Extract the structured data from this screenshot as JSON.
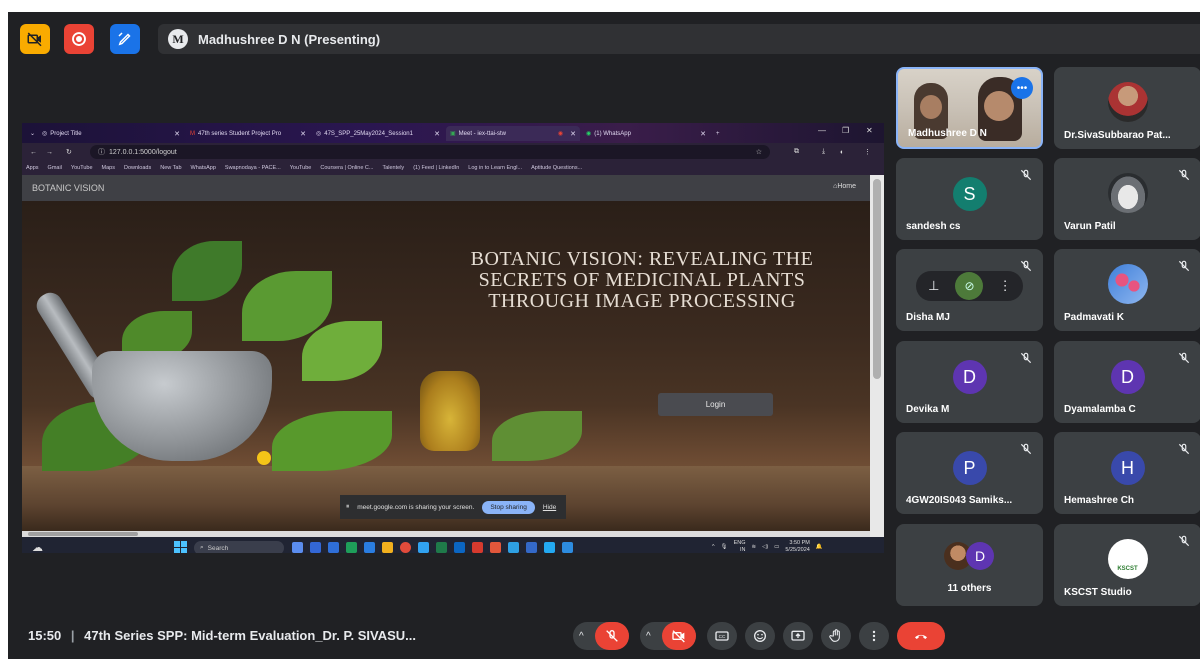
{
  "presenter": {
    "avatar_letter": "M",
    "label": "Madhushree D N (Presenting)"
  },
  "browser": {
    "tabs": [
      {
        "label": "Project Title",
        "icon": "globe-icon"
      },
      {
        "label": "47th series Student Project Pro",
        "icon": "gmail-icon"
      },
      {
        "label": "47S_SPP_25May2024_Session1",
        "icon": "globe-icon"
      },
      {
        "label": "Meet - iex-ttai-stw",
        "icon": "meet-icon"
      },
      {
        "label": "(1) WhatsApp",
        "icon": "whatsapp-icon"
      }
    ],
    "url": "127.0.0.1:5000/logout",
    "bookmarks": [
      "Apps",
      "Gmail",
      "YouTube",
      "Maps",
      "Downloads",
      "New Tab",
      "WhatsApp",
      "Swapnodaya - PACE...",
      "YouTube",
      "Coursera | Online C...",
      "Talentely",
      "(1) Feed | LinkedIn",
      "Log in to Learn Engl...",
      "Aptitude Questions..."
    ]
  },
  "site": {
    "brand": "BOTANIC VISION",
    "home_link": "Home",
    "hero_title": "BOTANIC VISION: REVEALING THE SECRETS OF MEDICINAL PLANTS THROUGH IMAGE PROCESSING",
    "login_label": "Login"
  },
  "share_notice": {
    "text": "meet.google.com is sharing your screen.",
    "stop_label": "Stop sharing",
    "hide_label": "Hide"
  },
  "taskbar": {
    "search_label": "Search",
    "lang_top": "ENG",
    "lang_bottom": "IN",
    "time": "3:50 PM",
    "date": "5/25/2024"
  },
  "participants": [
    {
      "name": "Madhushree D N",
      "type": "video"
    },
    {
      "name": "Dr.SivaSubbarao Pat...",
      "type": "photo"
    },
    {
      "name": "sandesh cs",
      "type": "letter",
      "letter": "S",
      "color": "#137e6f"
    },
    {
      "name": "Varun Patil",
      "type": "photo"
    },
    {
      "name": "Disha MJ",
      "type": "hover"
    },
    {
      "name": "Padmavati K",
      "type": "photo"
    },
    {
      "name": "Devika M",
      "type": "letter",
      "letter": "D",
      "color": "#5e35b1"
    },
    {
      "name": "Dyamalamba C",
      "type": "letter",
      "letter": "D",
      "color": "#5e35b1"
    },
    {
      "name": "4GW20IS043 Samiks...",
      "type": "letter",
      "letter": "P",
      "color": "#3949ab"
    },
    {
      "name": "Hemashree Ch",
      "type": "letter",
      "letter": "H",
      "color": "#3949ab"
    },
    {
      "name": "11 others",
      "type": "others",
      "letter": "D"
    },
    {
      "name": "KSCST Studio",
      "type": "logo",
      "logo_text": "KSCST"
    }
  ],
  "meeting": {
    "time": "15:50",
    "separator": "|",
    "title": "47th Series SPP: Mid-term Evaluation_Dr. P. SIVASU..."
  },
  "colors": {
    "background": "#202124",
    "tile": "#3c4043",
    "danger": "#ea4335",
    "accent": "#8ab4f8"
  }
}
